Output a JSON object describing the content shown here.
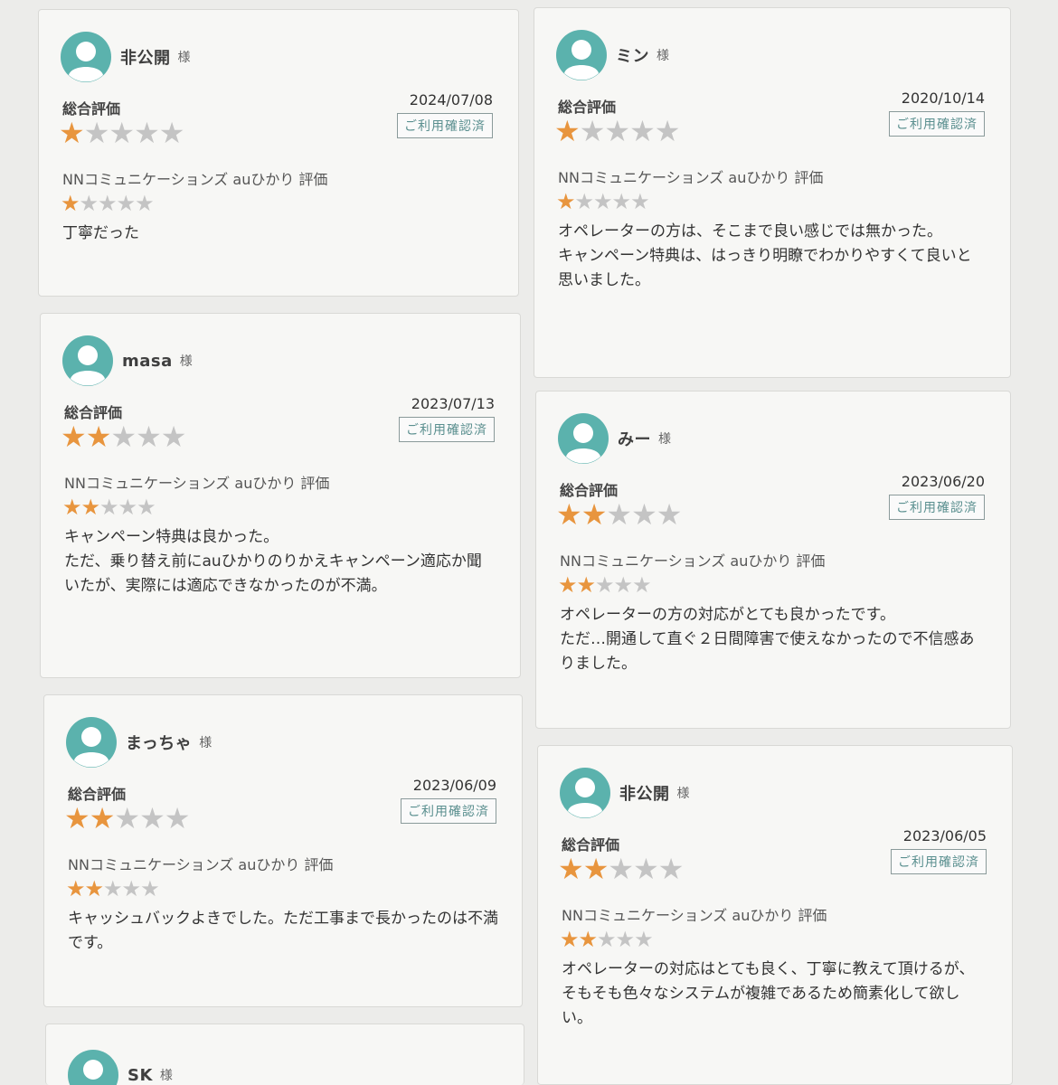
{
  "common": {
    "honorific": "様",
    "overall_label": "総合評価",
    "confirm_badge": "ご利用確認済",
    "provider_label": "NNコミュニケーションズ auひかり 評価"
  },
  "colors": {
    "star_filled": "#e8953e",
    "star_empty": "#c4c4c4",
    "avatar": "#5bb2ad",
    "badge_text": "#5a8f8f"
  },
  "reviews": [
    {
      "name": "非公開",
      "date": "2024/07/08",
      "overall_rating": 1,
      "provider_rating": 1,
      "comment": "丁寧だった"
    },
    {
      "name": "ミン",
      "date": "2020/10/14",
      "overall_rating": 1,
      "provider_rating": 1,
      "comment": "オペレーターの方は、そこまで良い感じでは無かった。\nキャンペーン特典は、はっきり明瞭でわかりやすくて良いと思いました。"
    },
    {
      "name": "masa",
      "date": "2023/07/13",
      "overall_rating": 2,
      "provider_rating": 2,
      "comment": "キャンペーン特典は良かった。\nただ、乗り替え前にauひかりのりかえキャンペーン適応か聞いたが、実際には適応できなかったのが不満。"
    },
    {
      "name": "みー",
      "date": "2023/06/20",
      "overall_rating": 2,
      "provider_rating": 2,
      "comment": "オペレーターの方の対応がとても良かったです。\nただ…開通して直ぐ２日間障害で使えなかったので不信感ありました。"
    },
    {
      "name": "まっちゃ",
      "date": "2023/06/09",
      "overall_rating": 2,
      "provider_rating": 2,
      "comment": "キャッシュバックよきでした。ただ工事まで長かったのは不満です。"
    },
    {
      "name": "非公開",
      "date": "2023/06/05",
      "overall_rating": 2,
      "provider_rating": 2,
      "comment": "オペレーターの対応はとても良く、丁寧に教えて頂けるが、そもそも色々なシステムが複雑であるため簡素化して欲しい。"
    },
    {
      "name": "SK"
    }
  ]
}
